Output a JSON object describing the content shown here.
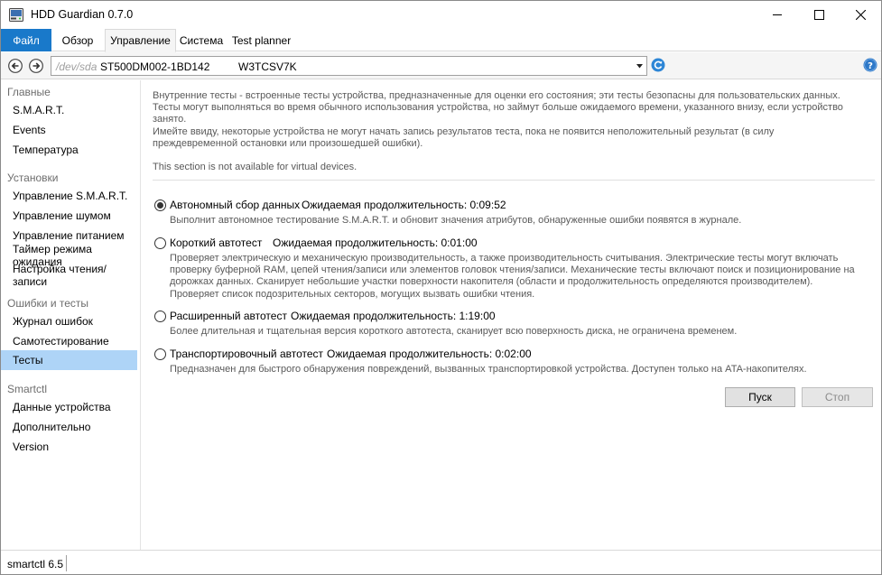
{
  "window": {
    "title": "HDD Guardian 0.7.0"
  },
  "menu": {
    "file": "Файл",
    "tabs": [
      "Обзор",
      "Управление",
      "Система",
      "Test planner"
    ],
    "active_tab": "Управление"
  },
  "device": {
    "path": "/dev/sda",
    "model": "ST500DM002-1BD142",
    "serial": "W3TCSV7K"
  },
  "sidebar": {
    "groups": [
      {
        "title": "Главные",
        "items": [
          "S.M.A.R.T.",
          "Events",
          "Температура"
        ]
      },
      {
        "title": "Установки",
        "items": [
          "Управление S.M.A.R.T.",
          "Управление шумом",
          "Управление питанием",
          "Таймер режима ожидания",
          "Настройка чтения/записи"
        ]
      },
      {
        "title": "Ошибки и тесты",
        "items": [
          "Журнал ошибок",
          "Самотестирование",
          "Тесты"
        ]
      },
      {
        "title": "Smartctl",
        "items": [
          "Данные устройства",
          "Дополнительно",
          "Version"
        ]
      }
    ],
    "selected": "Тесты"
  },
  "content": {
    "intro_1": "Внутренние тесты - встроенные тесты устройства, предназначенные для оценки его состояния; эти тесты безопасны для пользовательских данных.",
    "intro_2": "Тесты могут выполняться во время обычного использования устройства, но займут больше ожидаемого времени, указанного внизу, если устройство",
    "intro_3": "занято.",
    "intro_4": "Имейте ввиду, некоторые устройства не могут начать запись результатов теста, пока не появится неположительный результат (в силу",
    "intro_5": "преждевременной остановки или произошедшей ошибки).",
    "virtual_note": "This section is not available for virtual devices.",
    "tests": [
      {
        "label": "Автономный сбор данных",
        "duration": "Ожидаемая продолжительность: 0:09:52",
        "checked": true,
        "desc": [
          "Выполнит автономное тестирование S.M.A.R.T. и обновит значения атрибутов, обнаруженные ошибки появятся в журнале."
        ]
      },
      {
        "label": "Короткий автотест",
        "duration": "Ожидаемая продолжительность: 0:01:00",
        "checked": false,
        "desc": [
          "Проверяет электрическую и механическую производительность, а также производительность считывания. Электрические тесты могут включать",
          "проверку буферной RAM, цепей чтения/записи или элементов головок чтения/записи. Механические тесты включают поиск и позиционирование на",
          "дорожках данных. Сканирует небольшие участки поверхности накопителя (области и продолжительность определяются производителем).",
          "Проверяет список подозрительных секторов, могущих вызвать ошибки чтения."
        ]
      },
      {
        "label": "Расширенный автотест",
        "duration": "Ожидаемая продолжительность: 1:19:00",
        "checked": false,
        "desc": [
          "Более длительная и тщательная версия короткого автотеста, сканирует всю поверхность диска, не ограничена временем."
        ]
      },
      {
        "label": "Транспортировочный автотест",
        "duration": "Ожидаемая продолжительность: 0:02:00",
        "checked": false,
        "desc": [
          "Предназначен для быстрого обнаружения повреждений, вызванных транспортировкой устройства. Доступен только на ATA-накопителях."
        ]
      }
    ],
    "start_button": "Пуск",
    "stop_button": "Стоп"
  },
  "status": {
    "text": "smartctl 6.5"
  },
  "colors": {
    "accent": "#1979ca",
    "selection": "#aed4f7"
  }
}
